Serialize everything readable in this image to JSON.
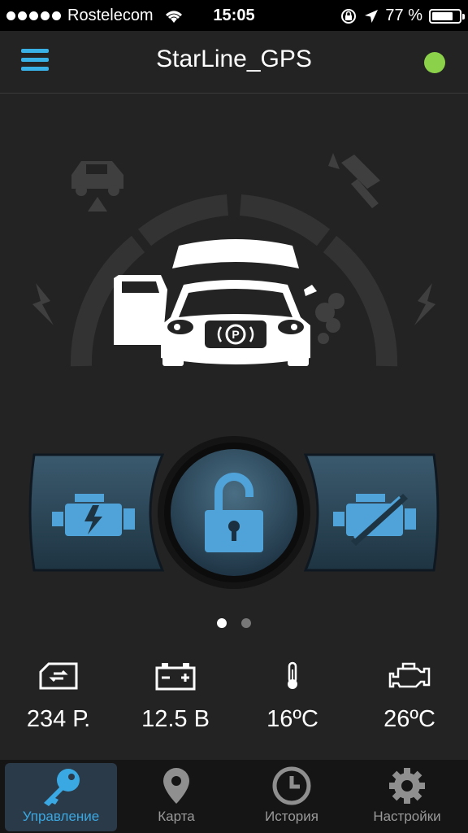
{
  "status_bar": {
    "carrier": "Rostelecom",
    "time": "15:05",
    "battery_percent_text": "77 %",
    "battery_level": 0.77,
    "icons": [
      "signal-dots-icon",
      "wifi-icon",
      "rotation-lock-icon",
      "location-arrow-icon",
      "battery-icon"
    ]
  },
  "header": {
    "title": "StarLine_GPS",
    "connection_status_color": "#8cd14a",
    "menu_icon": "hamburger-menu-icon"
  },
  "car_status": {
    "icons": [
      "tow-alarm-icon",
      "hammer-impact-icon",
      "shock-sensor-left-icon",
      "shock-sensor-right-icon",
      "car-icon",
      "parking-brake-icon",
      "exhaust-smoke-icon"
    ],
    "door_open": true,
    "hood_open": true
  },
  "controls": {
    "left_icon": "engine-start-icon",
    "center_icon": "unlocked-padlock-icon",
    "right_icon": "engine-stop-icon"
  },
  "pagination": {
    "count": 2,
    "active": 0
  },
  "stats": [
    {
      "icon": "balance-card-icon",
      "value": "234 Р."
    },
    {
      "icon": "car-battery-icon",
      "value": "12.5 В"
    },
    {
      "icon": "thermometer-icon",
      "value": "16ºC"
    },
    {
      "icon": "engine-temperature-icon",
      "value": "26ºC"
    }
  ],
  "tabs": [
    {
      "label": "Управление",
      "icon": "key-icon",
      "active": true
    },
    {
      "label": "Карта",
      "icon": "map-pin-icon",
      "active": false
    },
    {
      "label": "История",
      "icon": "clock-icon",
      "active": false
    },
    {
      "label": "Настройки",
      "icon": "gear-icon",
      "active": false
    }
  ],
  "colors": {
    "accent": "#39b0e6",
    "background": "#232323",
    "icon_gray": "#444444",
    "button_blue": "#2a4a5e"
  }
}
